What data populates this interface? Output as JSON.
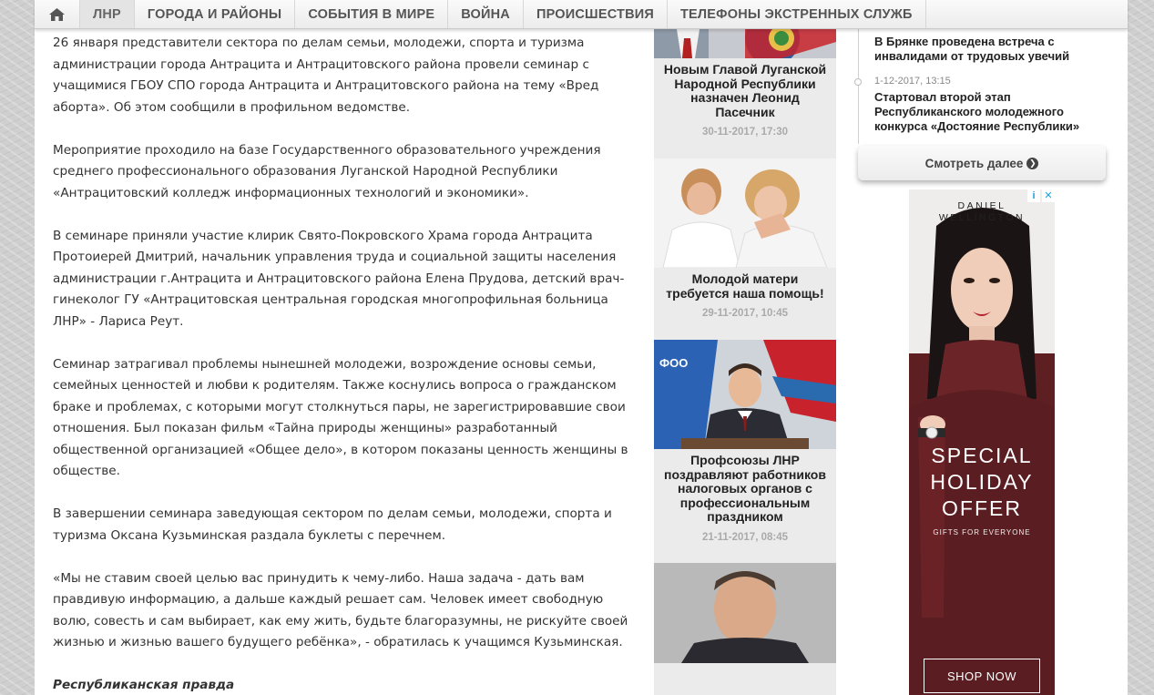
{
  "nav": {
    "home_icon": "home-icon",
    "items": [
      "ЛНР",
      "ГОРОДА И РАЙОНЫ",
      "СОБЫТИЯ В МИРЕ",
      "ВОЙНА",
      "ПРОИСШЕСТВИЯ",
      "ТЕЛЕФОНЫ ЭКСТРЕННЫХ СЛУЖБ"
    ],
    "active_index": 0
  },
  "article": {
    "paragraphs": [
      "26 января представители сектора по делам семьи, молодежи, спорта и туризма администрации города Антрацита и Антрацитовского района провели семинар с учащимися ГБОУ СПО города Антрацита и Антрацитовского района на тему «Вред аборта». Об этом сообщили в профильном ведомстве.",
      "Мероприятие проходило на базе Государственного образовательного учреждения среднего профессионального образования Луганской Народной Республики «Антрацитовский колледж информационных технологий и экономики».",
      "В семинаре приняли участие клирик Свято-Покровского Храма города Антрацита Протоиерей Дмитрий, начальник управления труда и социальной защиты населения администрации г.Антрацита и Антрацитовского района  Елена Прудова, детский врач-гинеколог ГУ «Антрацитовская центральная городская многопрофильная больница ЛНР» - Лариса Реут.",
      "Семинар затрагивал проблемы нынешней молодежи, возрождение основы семьи, семейных ценностей и любви к родителям. Также коснулись вопроса о гражданском браке и проблемах, с которыми могут столкнуться пары, не зарегистрировавшие свои отношения. Был показан фильм «Тайна природы женщины» разработанный  общественной организацией «Общее дело», в котором показаны ценность женщины в обществе.",
      "В завершении семинара заведующая сектором по делам семьи, молодежи, спорта и туризма Оксана Кузьминская раздала буклеты с перечнем.",
      "«Мы не ставим своей целью вас принудить к чему-либо. Наша задача - дать вам правдивую информацию, а дальше каждый решает сам. Человек имеет свободную волю, совесть и сам выбирает, как ему жить, будьте благоразумны, не рискуйте своей жизнью и жизнью вашего будущего ребёнка», - обратилась к учащимся Кузьминская."
    ],
    "source": "Республиканская правда"
  },
  "news": [
    {
      "title": "Новым Главой Луганской Народной Республики назначен Леонид Пасечник",
      "date": "30-11-2017, 17:30"
    },
    {
      "title": "Молодой матери требуется наша помощь!",
      "date": "29-11-2017, 10:45"
    },
    {
      "title": "Профсоюзы ЛНР поздравляют работников налоговых органов с профессиональным праздником",
      "date": "21-11-2017, 08:45"
    }
  ],
  "timeline": [
    {
      "date": "",
      "title": "В Брянке проведена встреча с инвалидами от трудовых увечий"
    },
    {
      "date": "1-12-2017, 13:15",
      "title": "Стартовал второй этап Республиканского молодежного конкурса «Достояние Республики»"
    }
  ],
  "more_button": "Смотреть далее",
  "ad": {
    "brand_line1": "DANIEL",
    "brand_line2": "WELLINGTON",
    "offer_line1": "SPECIAL",
    "offer_line2": "HOLIDAY",
    "offer_line3": "OFFER",
    "sub": "GIFTS FOR EVERYONE",
    "cta": "SHOP NOW"
  }
}
